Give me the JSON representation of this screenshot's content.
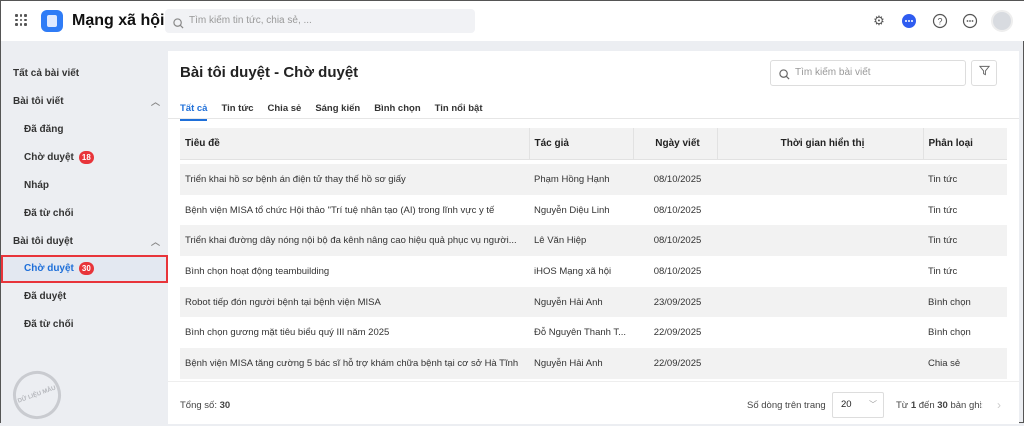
{
  "app": {
    "title": "Mạng xã hội",
    "search_placeholder": "Tìm kiếm tin tức, chia sẻ, ..."
  },
  "topbar_icons": [
    "gear-icon",
    "chat-icon",
    "help-icon",
    "more-icon"
  ],
  "sidebar": {
    "all_posts": "Tất cả bài viết",
    "my_posts": {
      "label": "Bài tôi viết",
      "items": [
        {
          "label": "Đã đăng"
        },
        {
          "label": "Chờ duyệt",
          "badge": "18"
        },
        {
          "label": "Nháp"
        },
        {
          "label": "Đã từ chối"
        }
      ]
    },
    "my_reviews": {
      "label": "Bài tôi duyệt",
      "items": [
        {
          "label": "Chờ duyệt",
          "badge": "30"
        },
        {
          "label": "Đã duyệt"
        },
        {
          "label": "Đã từ chối"
        }
      ]
    },
    "stamp": "DỮ LIỆU MẪU"
  },
  "main": {
    "title": "Bài tôi duyệt - Chờ duyệt",
    "search_placeholder": "Tìm kiếm bài viết",
    "tabs": [
      "Tất cả",
      "Tin tức",
      "Chia sẻ",
      "Sáng kiến",
      "Bình chọn",
      "Tin nổi bật"
    ],
    "columns": [
      "Tiêu đề",
      "Tác giả",
      "Ngày viết",
      "Thời gian hiển thị",
      "Phân loại"
    ],
    "rows": [
      [
        "Triển khai hồ sơ bệnh án điện tử thay thế hồ sơ giấy",
        "Phạm Hồng Hạnh",
        "08/10/2025",
        "",
        "Tin tức"
      ],
      [
        "Bệnh viện MISA tổ chức Hội thảo \"Trí tuệ nhân tạo (AI) trong lĩnh vực y tế",
        "Nguyễn Diệu Linh",
        "08/10/2025",
        "",
        "Tin tức"
      ],
      [
        "Triển khai đường dây nóng nội bộ đa kênh nâng cao hiệu quả phục vụ người...",
        "Lê Văn Hiệp",
        "08/10/2025",
        "",
        "Tin tức"
      ],
      [
        "Bình chọn hoạt động teambuilding",
        "iHOS Mạng xã hội",
        "08/10/2025",
        "",
        "Tin tức"
      ],
      [
        "Robot tiếp đón người bệnh tại bệnh viện MISA",
        "Nguyễn Hải Anh",
        "23/09/2025",
        "",
        "Bình chọn"
      ],
      [
        "Bình chọn gương mặt tiêu biểu quý III năm 2025",
        "Đỗ Nguyên Thanh T...",
        "22/09/2025",
        "",
        "Bình chọn"
      ],
      [
        "Bệnh viện MISA tăng cường 5 bác sĩ hỗ trợ khám chữa bệnh tại cơ sở Hà Tĩnh",
        "Nguyễn Hải Anh",
        "22/09/2025",
        "",
        "Chia sẻ"
      ]
    ],
    "footer": {
      "total_label": "Tổng số:",
      "total": "30",
      "rows_per_page_label": "Số dòng trên trang",
      "rows_per_page": "20",
      "range_from_label": "Từ",
      "range_from": "1",
      "range_to_label": "đến",
      "range_to": "30",
      "range_suffix": "bản ghi"
    }
  }
}
